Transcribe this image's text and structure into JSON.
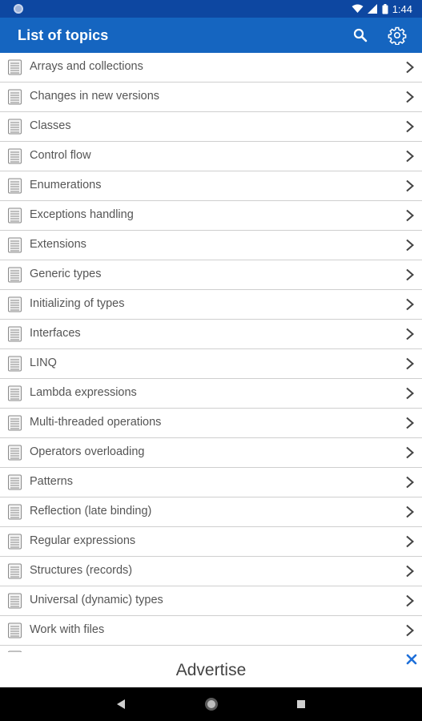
{
  "status_bar": {
    "time": "1:44"
  },
  "app_bar": {
    "title": "List of topics"
  },
  "topics": [
    {
      "label": "Arrays and collections"
    },
    {
      "label": "Changes in new versions"
    },
    {
      "label": "Classes"
    },
    {
      "label": "Control flow"
    },
    {
      "label": "Enumerations"
    },
    {
      "label": "Exceptions handling"
    },
    {
      "label": "Extensions"
    },
    {
      "label": "Generic types"
    },
    {
      "label": "Initializing of types"
    },
    {
      "label": "Interfaces"
    },
    {
      "label": "LINQ"
    },
    {
      "label": "Lambda expressions"
    },
    {
      "label": "Multi-threaded operations"
    },
    {
      "label": "Operators overloading"
    },
    {
      "label": "Patterns"
    },
    {
      "label": "Reflection (late binding)"
    },
    {
      "label": "Regular expressions"
    },
    {
      "label": "Structures (records)"
    },
    {
      "label": "Universal (dynamic) types"
    },
    {
      "label": "Work with files"
    }
  ],
  "ad": {
    "text": "Advertise"
  },
  "colors": {
    "status_bar": "#0d47a1",
    "app_bar": "#1565c0",
    "ad_close": "#1e6fd9"
  },
  "icons": [
    "search-icon",
    "gear-icon",
    "document-icon",
    "chevron-right-icon",
    "close-icon",
    "back-icon",
    "home-icon",
    "recents-icon"
  ]
}
